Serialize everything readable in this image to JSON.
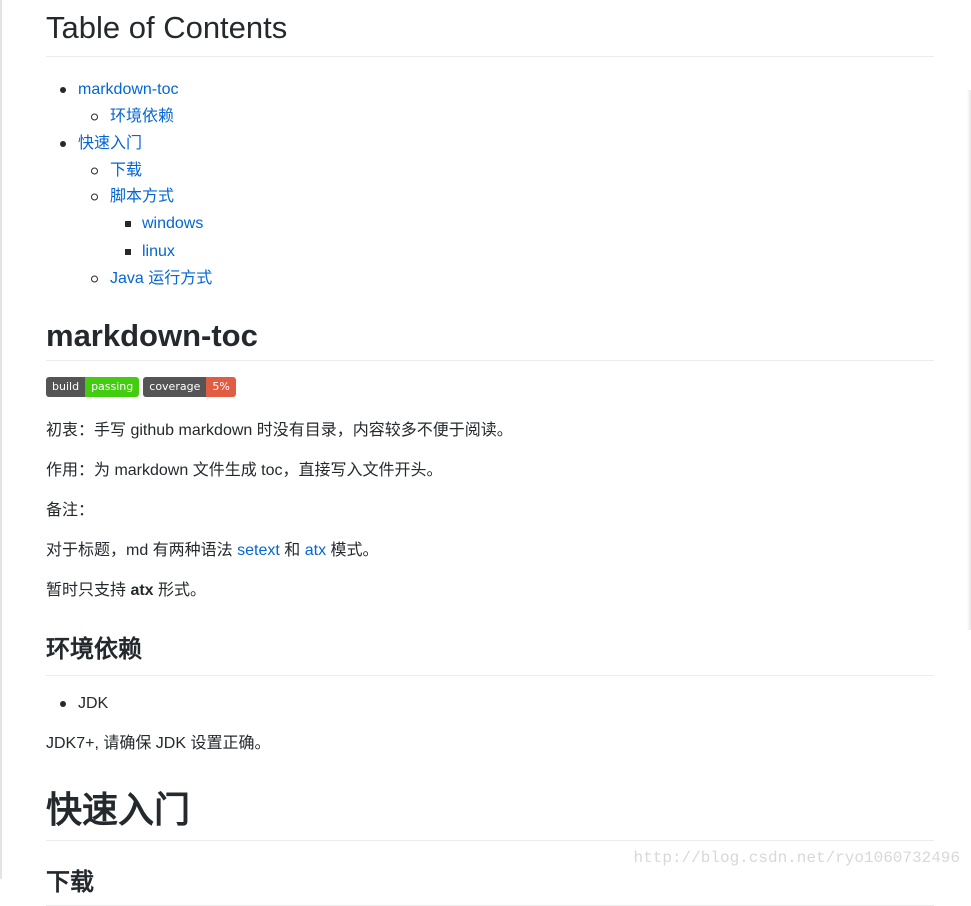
{
  "toc": {
    "title": "Table of Contents",
    "items": [
      {
        "label": "markdown-toc",
        "children": [
          {
            "label": "环境依赖"
          }
        ]
      },
      {
        "label": "快速入门",
        "children": [
          {
            "label": "下载"
          },
          {
            "label": "脚本方式",
            "children": [
              {
                "label": "windows"
              },
              {
                "label": "linux"
              }
            ]
          },
          {
            "label": "Java 运行方式"
          }
        ]
      }
    ]
  },
  "section_md": {
    "title": "markdown-toc",
    "badges": [
      {
        "label": "build",
        "value": "passing",
        "color": "#44cc11"
      },
      {
        "label": "coverage",
        "value": "5%",
        "color": "#e05d44"
      }
    ],
    "p_origin": "初衷：手写 github markdown 时没有目录，内容较多不便于阅读。",
    "p_usage": "作用：为 markdown 文件生成 toc，直接写入文件开头。",
    "p_note": "备注：",
    "p_heading_pre": "对于标题，md 有两种语法 ",
    "link_setext": "setext",
    "p_heading_mid": " 和 ",
    "link_atx": "atx",
    "p_heading_post": " 模式。",
    "p_support_pre": "暂时只支持 ",
    "p_support_bold": "atx",
    "p_support_post": " 形式。"
  },
  "section_env": {
    "title": "环境依赖",
    "items": [
      "JDK"
    ],
    "note": "JDK7+, 请确保 JDK 设置正确。"
  },
  "section_quick": {
    "title": "快速入门"
  },
  "section_download": {
    "title": "下载"
  },
  "watermark": "http://blog.csdn.net/ryo1060732496",
  "colors": {
    "link": "#0366d6",
    "text": "#24292e",
    "badge_label": "#555555"
  }
}
